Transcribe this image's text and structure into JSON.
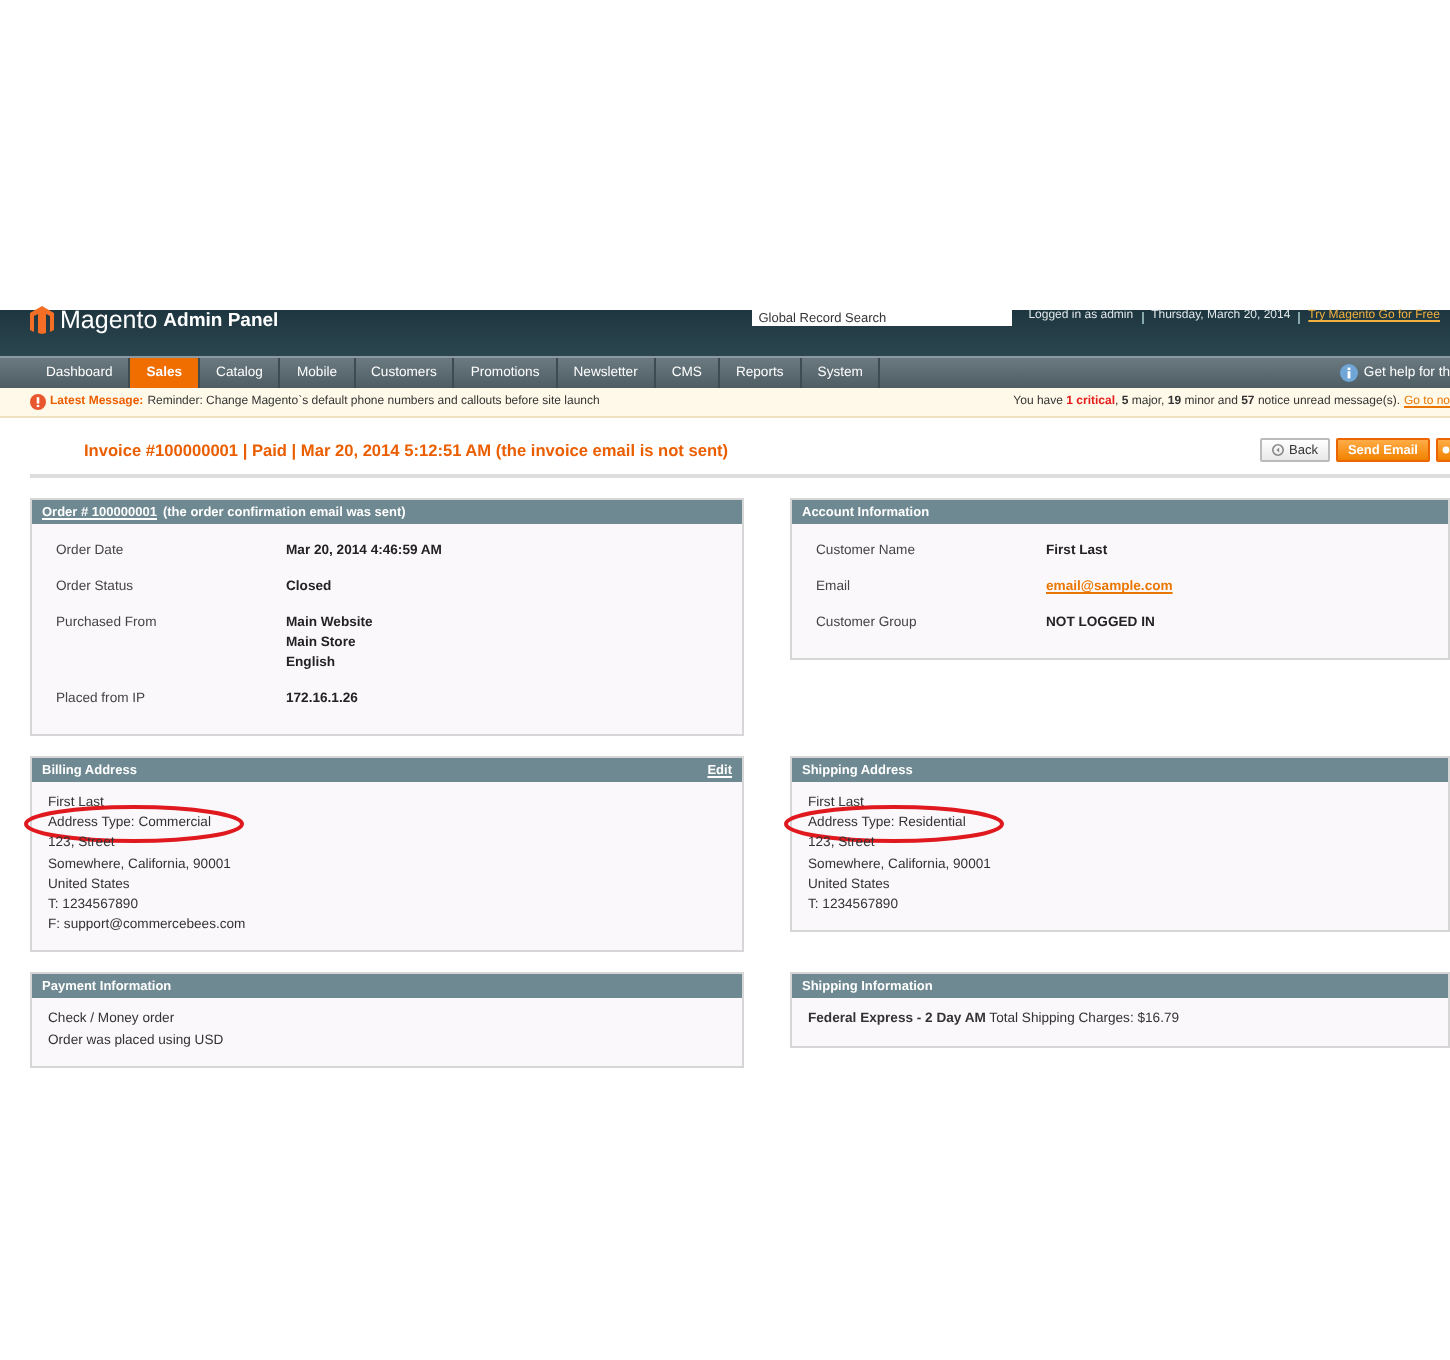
{
  "header": {
    "logo": "Magento",
    "logo_suffix": "Admin Panel",
    "search_placeholder": "Global Record Search",
    "user": "Logged in as admin",
    "date": "Thursday, March 20, 2014",
    "promo_link": "Try Magento Go for Free"
  },
  "nav": [
    {
      "label": "Dashboard",
      "selected": false
    },
    {
      "label": "Sales",
      "selected": true
    },
    {
      "label": "Catalog",
      "selected": false
    },
    {
      "label": "Mobile",
      "selected": false
    },
    {
      "label": "Customers",
      "selected": false
    },
    {
      "label": "Promotions",
      "selected": false
    },
    {
      "label": "Newsletter",
      "selected": false
    },
    {
      "label": "CMS",
      "selected": false
    },
    {
      "label": "Reports",
      "selected": false
    },
    {
      "label": "System",
      "selected": false
    }
  ],
  "help": "Get help for th",
  "message": {
    "label": "Latest Message:",
    "text": "Reminder: Change Magento`s default phone numbers and callouts before site launch",
    "counts": "You have **1 critical**, **5** major, **19** minor and **57** notice unread message(s).",
    "link": "Go to no"
  },
  "title": "Invoice #100000001 | Paid | Mar 20, 2014 5:12:51 AM (the invoice email is not sent)",
  "buttons": [
    {
      "kind": "back",
      "label": "Back"
    },
    {
      "kind": "primary",
      "label": "Send Email"
    },
    {
      "kind": "icon"
    }
  ],
  "panels": [
    {
      "kind": "fields",
      "title_link": "Order # 100000001",
      "title": "(the order confirmation email was sent)",
      "fields": [
        {
          "label": "Order Date",
          "values": [
            "Mar 20, 2014 4:46:59 AM"
          ]
        },
        {
          "label": "Order Status",
          "values": [
            "Closed"
          ]
        },
        {
          "label": "Purchased From",
          "values": [
            "Main Website",
            "Main Store",
            "English"
          ]
        },
        {
          "label": "Placed from IP",
          "values": [
            "172.16.1.26"
          ]
        }
      ]
    },
    {
      "kind": "fields",
      "title": "Account Information",
      "fields": [
        {
          "label": "Customer Name",
          "values": [
            "First Last"
          ]
        },
        {
          "label": "Email",
          "values": [
            "email@sample.com"
          ],
          "link": true
        },
        {
          "label": "Customer Group",
          "values": [
            "NOT LOGGED IN"
          ]
        }
      ]
    },
    {
      "kind": "lines",
      "title": "Billing Address",
      "edit": "Edit",
      "lines": [
        {
          "text": "First Last",
          "circled": false
        },
        {
          "text": "Address Type: Commercial",
          "circled": true
        },
        {
          "text": "123, Street",
          "circled": false
        },
        {
          "text": "Somewhere, California, 90001",
          "circled": false
        },
        {
          "text": "United States",
          "circled": false
        },
        {
          "text": "T: 1234567890",
          "circled": false
        },
        {
          "text": "F: support@commercebees.com",
          "circled": false
        }
      ]
    },
    {
      "kind": "lines",
      "title": "Shipping Address",
      "lines": [
        {
          "text": "First Last",
          "circled": false
        },
        {
          "text": "Address Type: Residential",
          "circled": true
        },
        {
          "text": "123, Street",
          "circled": false
        },
        {
          "text": "Somewhere, California, 90001",
          "circled": false
        },
        {
          "text": "United States",
          "circled": false
        },
        {
          "text": "T: 1234567890",
          "circled": false
        }
      ]
    },
    {
      "kind": "lines",
      "title": "Payment Information",
      "lines": [
        {
          "text": "Check / Money order",
          "circled": false
        },
        {
          "text": "Order was placed using USD",
          "circled": false
        }
      ]
    },
    {
      "kind": "lines",
      "title": "Shipping Information",
      "lines": [
        {
          "text": "**Federal Express - 2 Day AM** Total Shipping Charges: $16.79",
          "circled": false
        }
      ]
    }
  ]
}
